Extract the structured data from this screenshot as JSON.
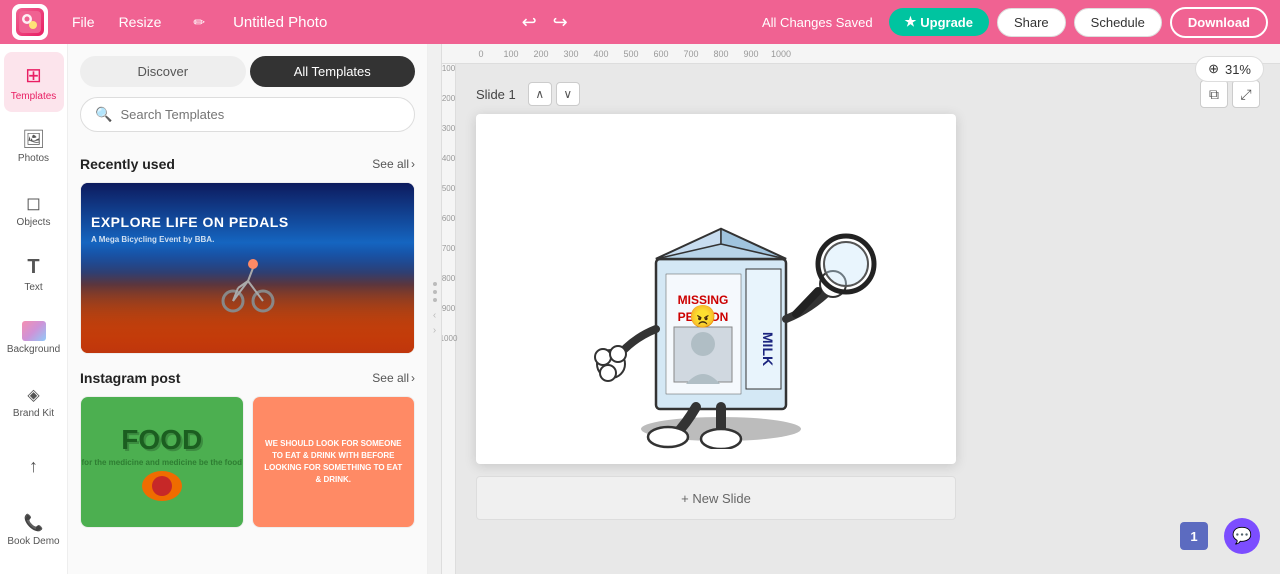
{
  "topbar": {
    "logo_text": "C",
    "menu": [
      "File",
      "Resize"
    ],
    "title": "Untitled Photo",
    "status": "All Changes Saved",
    "upgrade_label": "Upgrade",
    "share_label": "Share",
    "schedule_label": "Schedule",
    "download_label": "Download"
  },
  "toolbar_icons": {
    "undo_symbol": "↩",
    "redo_symbol": "↪",
    "edit_symbol": "✏"
  },
  "sidebar": {
    "items": [
      {
        "id": "templates",
        "label": "Templates",
        "symbol": "⊞",
        "active": true
      },
      {
        "id": "photos",
        "label": "Photos",
        "symbol": "🖼",
        "active": false
      },
      {
        "id": "objects",
        "label": "Objects",
        "symbol": "◻",
        "active": false
      },
      {
        "id": "text",
        "label": "Text",
        "symbol": "T",
        "active": false
      },
      {
        "id": "background",
        "label": "Background",
        "symbol": "BG",
        "active": false
      },
      {
        "id": "brandkit",
        "label": "Brand Kit",
        "symbol": "◈",
        "active": false
      },
      {
        "id": "upload",
        "label": "",
        "symbol": "↑",
        "active": false
      },
      {
        "id": "bookdemo",
        "label": "Book Demo",
        "symbol": "📞",
        "active": false
      }
    ]
  },
  "templates_panel": {
    "tab_discover": "Discover",
    "tab_all": "All Templates",
    "search_placeholder": "Search Templates",
    "recently_used_label": "Recently used",
    "see_all_label": "See all",
    "instagram_post_label": "Instagram post",
    "cycling_template": {
      "title": "EXPLORE LIFE ON PEDALS",
      "subtitle": "A Mega Bicycling Event by BBA."
    },
    "food_template_1": {
      "text": "FOOD"
    },
    "food_template_2": {
      "text": "WE SHOULD LOOK FOR SOMEONE TO EAT & DRINK WITH BEFORE LOOKING FOR SOMETHING TO EAT & DRINK."
    }
  },
  "canvas": {
    "zoom_percent": "31%",
    "slide_label": "Slide 1",
    "new_slide_label": "+ New Slide",
    "ruler_marks": [
      "100",
      "200",
      "300",
      "400",
      "500",
      "600",
      "700",
      "800",
      "900",
      "1000"
    ],
    "ruler_v_marks": [
      "100",
      "200",
      "300",
      "400",
      "500",
      "600",
      "700",
      "800",
      "900",
      "1000"
    ]
  },
  "bottom": {
    "slide_number": "1"
  },
  "icons": {
    "search": "🔍",
    "star": "★",
    "chevron_right": "›",
    "chevron_up": "∧",
    "chevron_down": "∨",
    "copy": "⧉",
    "expand": "⤢",
    "zoom_in": "⊕"
  }
}
